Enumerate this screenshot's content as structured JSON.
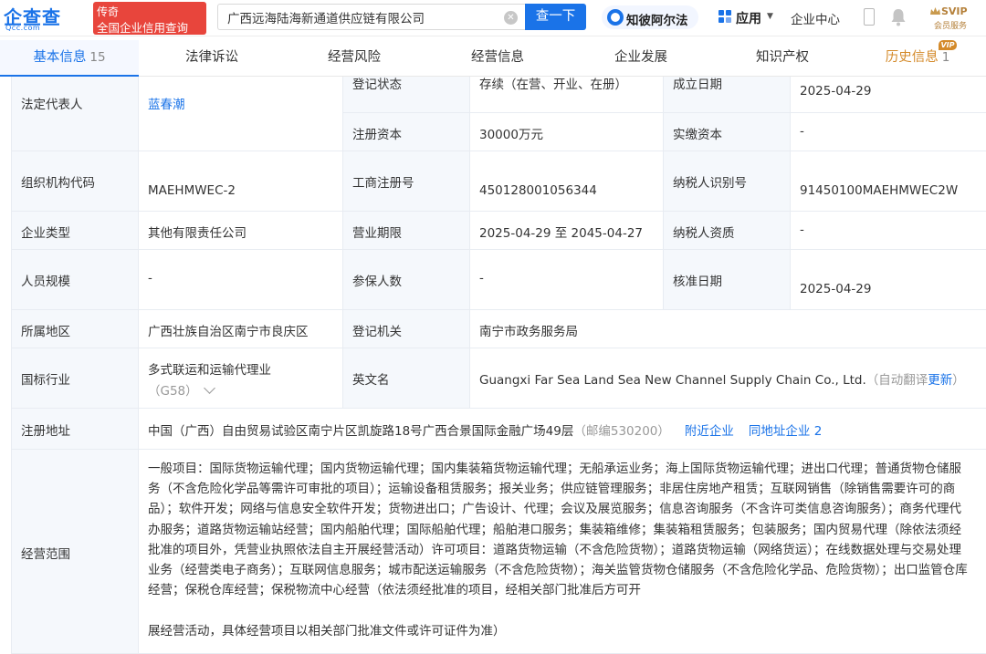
{
  "header": {
    "logo_main": "企查查",
    "logo_sub": "Qcc.com",
    "slogan_line1": "传奇",
    "slogan_line2": "全国企业信用查询",
    "search_value": "广西远海陆海新通道供应链有限公司",
    "search_button": "查一下",
    "zhibi_label": "知彼阿尔法",
    "app_label": "应用",
    "enterprise_center": "企业中心",
    "svip_top": "SVIP",
    "svip_bottom": "会员服务"
  },
  "tabs": [
    {
      "label": "基本信息",
      "count": "15",
      "active": true
    },
    {
      "label": "法律诉讼",
      "count": ""
    },
    {
      "label": "经营风险",
      "count": ""
    },
    {
      "label": "经营信息",
      "count": ""
    },
    {
      "label": "企业发展",
      "count": ""
    },
    {
      "label": "知识产权",
      "count": ""
    },
    {
      "label": "历史信息",
      "count": "1",
      "vip": "VIP"
    }
  ],
  "info": {
    "legal_rep_label": "法定代表人",
    "legal_rep_value": "蓝春潮",
    "reg_status_label": "登记状态",
    "reg_status_value": "存续（在营、开业、在册）",
    "founded_label": "成立日期",
    "founded_value": "2025-04-29",
    "reg_capital_label": "注册资本",
    "reg_capital_value": "30000万元",
    "paid_capital_label": "实缴资本",
    "paid_capital_value": "-",
    "org_code_label": "组织机构代码",
    "org_code_value": "MAEHMWEC-2",
    "biz_reg_no_label": "工商注册号",
    "biz_reg_no_value": "450128001056344",
    "taxpayer_id_label": "纳税人识别号",
    "taxpayer_id_value": "91450100MAEHMWEC2W",
    "company_type_label": "企业类型",
    "company_type_value": "其他有限责任公司",
    "biz_term_label": "营业期限",
    "biz_term_value": "2025-04-29 至 2045-04-27",
    "taxpayer_qual_label": "纳税人资质",
    "taxpayer_qual_value": "-",
    "staff_size_label": "人员规模",
    "staff_size_value": "-",
    "insured_label": "参保人数",
    "insured_value": "-",
    "approved_date_label": "核准日期",
    "approved_date_value": "2025-04-29",
    "region_label": "所属地区",
    "region_value": "广西壮族自治区南宁市良庆区",
    "reg_authority_label": "登记机关",
    "reg_authority_value": "南宁市政务服务局",
    "industry_label": "国标行业",
    "industry_value": "多式联运和运输代理业",
    "industry_code": "（G58）",
    "english_name_label": "英文名",
    "english_name_value": "Guangxi Far Sea Land Sea New Channel Supply Chain Co., Ltd.",
    "auto_translate": "（自动翻译",
    "update_link": "更新",
    "close_paren": "）",
    "address_label": "注册地址",
    "address_value": "中国（广西）自由贸易试验区南宁片区凯旋路18号广西合景国际金融广场49层",
    "postcode": "（邮编530200）",
    "nearby_link": "附近企业",
    "same_address_link": "同地址企业 2",
    "scope_label": "经营范围",
    "scope_value": "一般项目：国际货物运输代理；国内货物运输代理；国内集装箱货物运输代理；无船承运业务；海上国际货物运输代理；进出口代理；普通货物仓储服务（不含危险化学品等需许可审批的项目）；运输设备租赁服务；报关业务；供应链管理服务；非居住房地产租赁；互联网销售（除销售需要许可的商品）；软件开发；网络与信息安全软件开发；货物进出口；广告设计、代理；会议及展览服务；信息咨询服务（不含许可类信息咨询服务）；商务代理代办服务；道路货物运输站经营；国内船舶代理；国际船舶代理；船舶港口服务；集装箱维修；集装箱租赁服务；包装服务；国内贸易代理（除依法须经批准的项目外，凭营业执照依法自主开展经营活动）许可项目：道路货物运输（不含危险货物）；道路货物运输（网络货运）；在线数据处理与交易处理业务（经营类电子商务）；互联网信息服务；城市配送运输服务（不含危险货物）；海关监管货物仓储服务（不含危险化学品、危险货物）；出口监管仓库经营；保税仓库经营；保税物流中心经营（依法须经批准的项目，经相关部门批准后方可开",
    "scope_value_end": "展经营活动，具体经营项目以相关部门批准文件或许可证件为准）"
  },
  "colors": {
    "accent": "#1a73e8",
    "label_bg": "#f5f8fc",
    "slogan_bg": "#e8453c",
    "history_tab": "#d48a2a"
  }
}
